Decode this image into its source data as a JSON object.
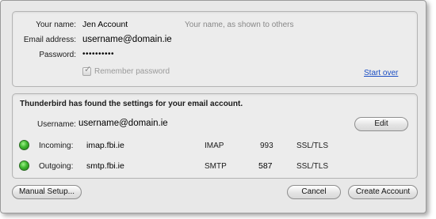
{
  "account": {
    "name_label": "Your name:",
    "name_value": "Jen Account",
    "name_hint": "Your name, as shown to others",
    "email_label": "Email address:",
    "email_value": "username@domain.ie",
    "password_label": "Password:",
    "password_value": "••••••••••",
    "remember_label": "Remember password",
    "remember_checked": true,
    "start_over_label": "Start over"
  },
  "settings": {
    "heading": "Thunderbird has found the settings for your email account.",
    "username_label": "Username:",
    "username_value": "username@domain.ie",
    "edit_label": "Edit",
    "servers": [
      {
        "label": "Incoming:",
        "host": "imap.fbi.ie",
        "protocol": "IMAP",
        "port": "993",
        "security": "SSL/TLS",
        "status": "green-status-icon"
      },
      {
        "label": "Outgoing:",
        "host": "smtp.fbi.ie",
        "protocol": "SMTP",
        "port": "587",
        "security": "SSL/TLS",
        "status": "green-status-icon"
      }
    ]
  },
  "footer": {
    "manual_setup_label": "Manual Setup...",
    "cancel_label": "Cancel",
    "create_account_label": "Create Account"
  },
  "colors": {
    "link": "#1c4fc4",
    "status_ok": "#3fb830"
  }
}
